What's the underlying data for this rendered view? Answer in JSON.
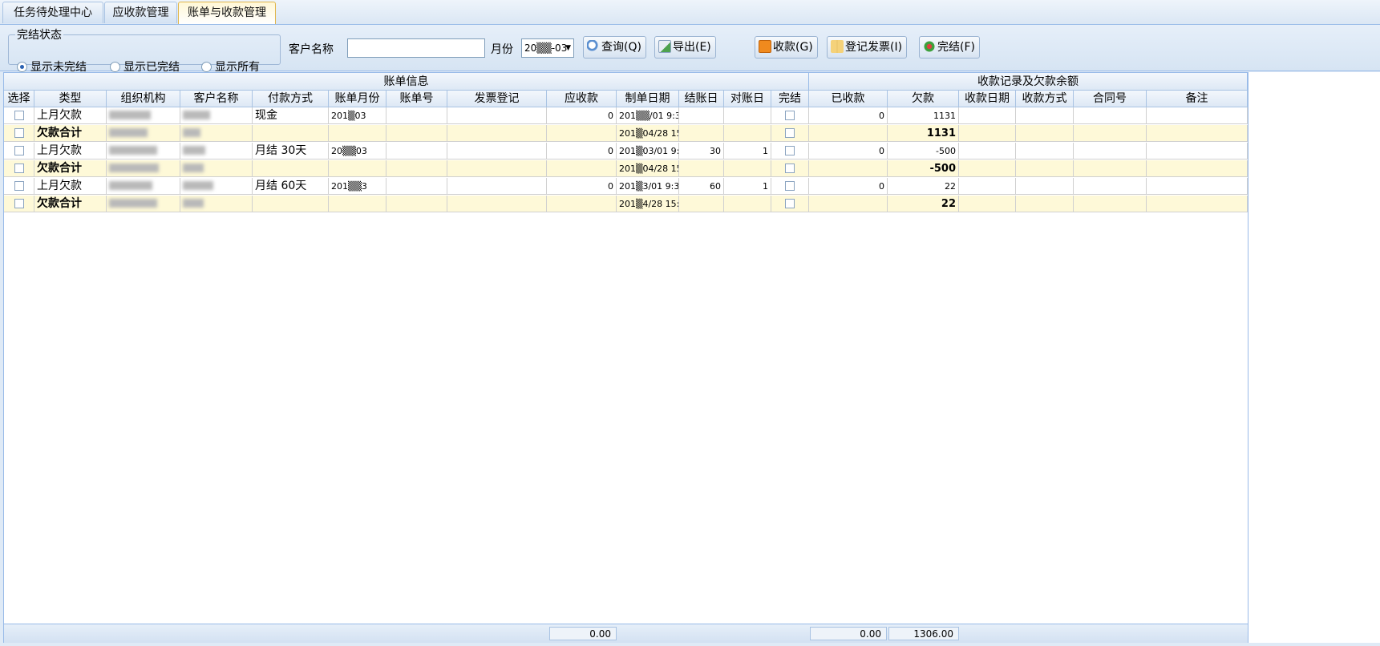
{
  "tabs": [
    {
      "label": "任务待处理中心"
    },
    {
      "label": "应收款管理"
    },
    {
      "label": "账单与收款管理"
    }
  ],
  "toolbar": {
    "status_legend": "完结状态",
    "radios": [
      {
        "label": "显示未完结",
        "checked": true
      },
      {
        "label": "显示已完结",
        "checked": false
      },
      {
        "label": "显示所有",
        "checked": false
      }
    ],
    "customer_label": "客户名称",
    "customer_value": "",
    "month_label": "月份",
    "month_value": "20▒▒-03",
    "query_button": "查询(Q)",
    "export_button": "导出(E)",
    "receive_button": "收款(G)",
    "invoice_button": "登记发票(I)",
    "finish_button": "完结(F)"
  },
  "grid": {
    "group_left": "账单信息",
    "group_right": "收款记录及欠款余额",
    "columns": [
      "选择",
      "类型",
      "组织机构",
      "客户名称",
      "付款方式",
      "账单月份",
      "账单号",
      "发票登记",
      "应收款",
      "制单日期",
      "结账日",
      "对账日",
      "完结",
      "已收款",
      "欠款",
      "收款日期",
      "收款方式",
      "合同号",
      "备注"
    ],
    "rows": [
      {
        "type": "上月欠款",
        "pay": "现金",
        "month": "201▒03",
        "receivable": "0",
        "date": "201▒▒/01 9:3",
        "settle": "",
        "check": "",
        "received": "0",
        "debt": "1131",
        "sum": false
      },
      {
        "type": "欠款合计",
        "pay": "",
        "month": "",
        "receivable": "",
        "date": "201▒04/28 15:",
        "settle": "",
        "check": "",
        "received": "",
        "debt": "1131",
        "sum": true
      },
      {
        "type": "上月欠款",
        "pay": "月结 30天",
        "month": "20▒▒03",
        "receivable": "0",
        "date": "201▒03/01 9:3",
        "settle": "30",
        "check": "1",
        "received": "0",
        "debt": "-500",
        "sum": false
      },
      {
        "type": "欠款合计",
        "pay": "",
        "month": "",
        "receivable": "",
        "date": "201▒04/28 15:",
        "settle": "",
        "check": "",
        "received": "",
        "debt": "-500",
        "sum": true
      },
      {
        "type": "上月欠款",
        "pay": "月结 60天",
        "month": "201▒▒3",
        "receivable": "0",
        "date": "201▒3/01 9:3",
        "settle": "60",
        "check": "1",
        "received": "0",
        "debt": "22",
        "sum": false
      },
      {
        "type": "欠款合计",
        "pay": "",
        "month": "",
        "receivable": "",
        "date": "201▒4/28 15:",
        "settle": "",
        "check": "",
        "received": "",
        "debt": "22",
        "sum": true
      }
    ]
  },
  "footer": {
    "receivable_total": "0.00",
    "received_total": "0.00",
    "debt_total": "1306.00"
  },
  "colors": {
    "summary_row": "#fef9d8",
    "header": "#dde8f5",
    "border": "#99bbe8"
  },
  "icons": {
    "query": "magnifier-icon",
    "export": "export-icon",
    "receive": "receive-icon",
    "invoice": "book-icon",
    "finish": "finish-icon"
  }
}
